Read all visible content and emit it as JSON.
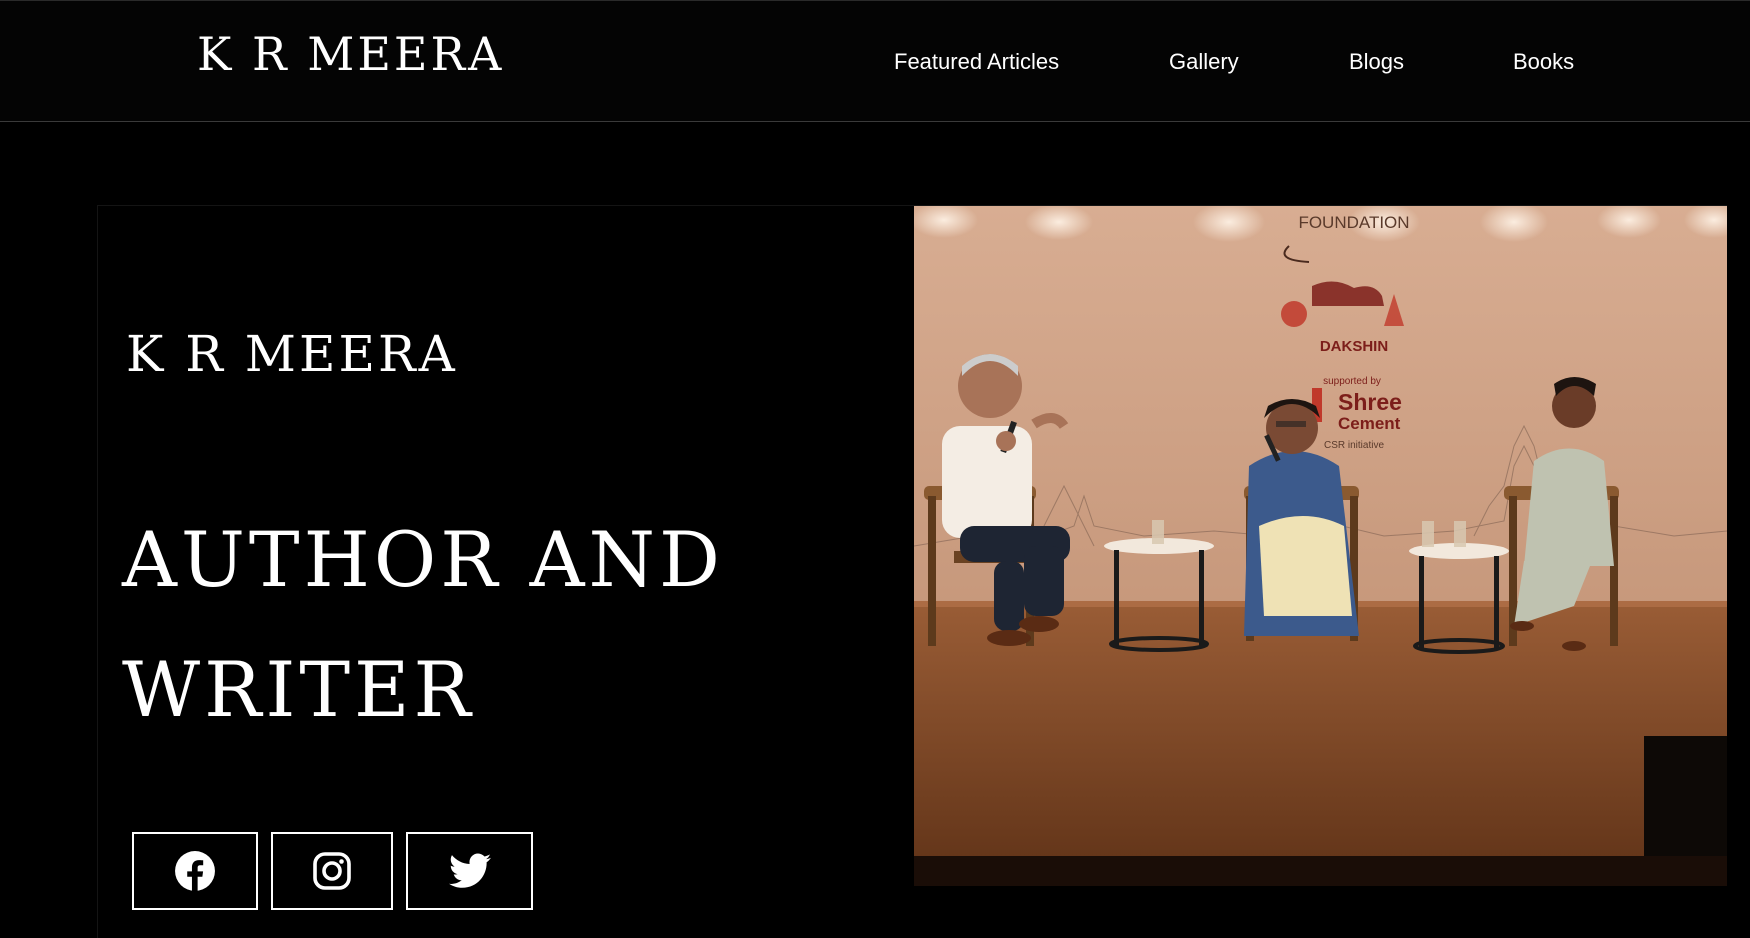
{
  "header": {
    "logo": "K R MEERA",
    "nav": [
      "Featured Articles",
      "Gallery",
      "Blogs",
      "Books"
    ]
  },
  "hero": {
    "name": "K R MEERA",
    "headline_line1": "AUTHOR AND",
    "headline_line2": "WRITER"
  },
  "social": [
    {
      "icon": "facebook-icon"
    },
    {
      "icon": "instagram-icon"
    },
    {
      "icon": "twitter-icon"
    }
  ],
  "photo": {
    "banner_line1": "FOUNDATION",
    "banner_line2": "DAKSHIN",
    "sponsor_label": "supported by",
    "sponsor_name_1": "Shree",
    "sponsor_name_2": "Cement",
    "sponsor_tagline": "CSR initiative"
  },
  "colors": {
    "background": "#000000",
    "text": "#ffffff",
    "stage_wall": "#c99b7f",
    "stage_floor": "#7a4526"
  }
}
